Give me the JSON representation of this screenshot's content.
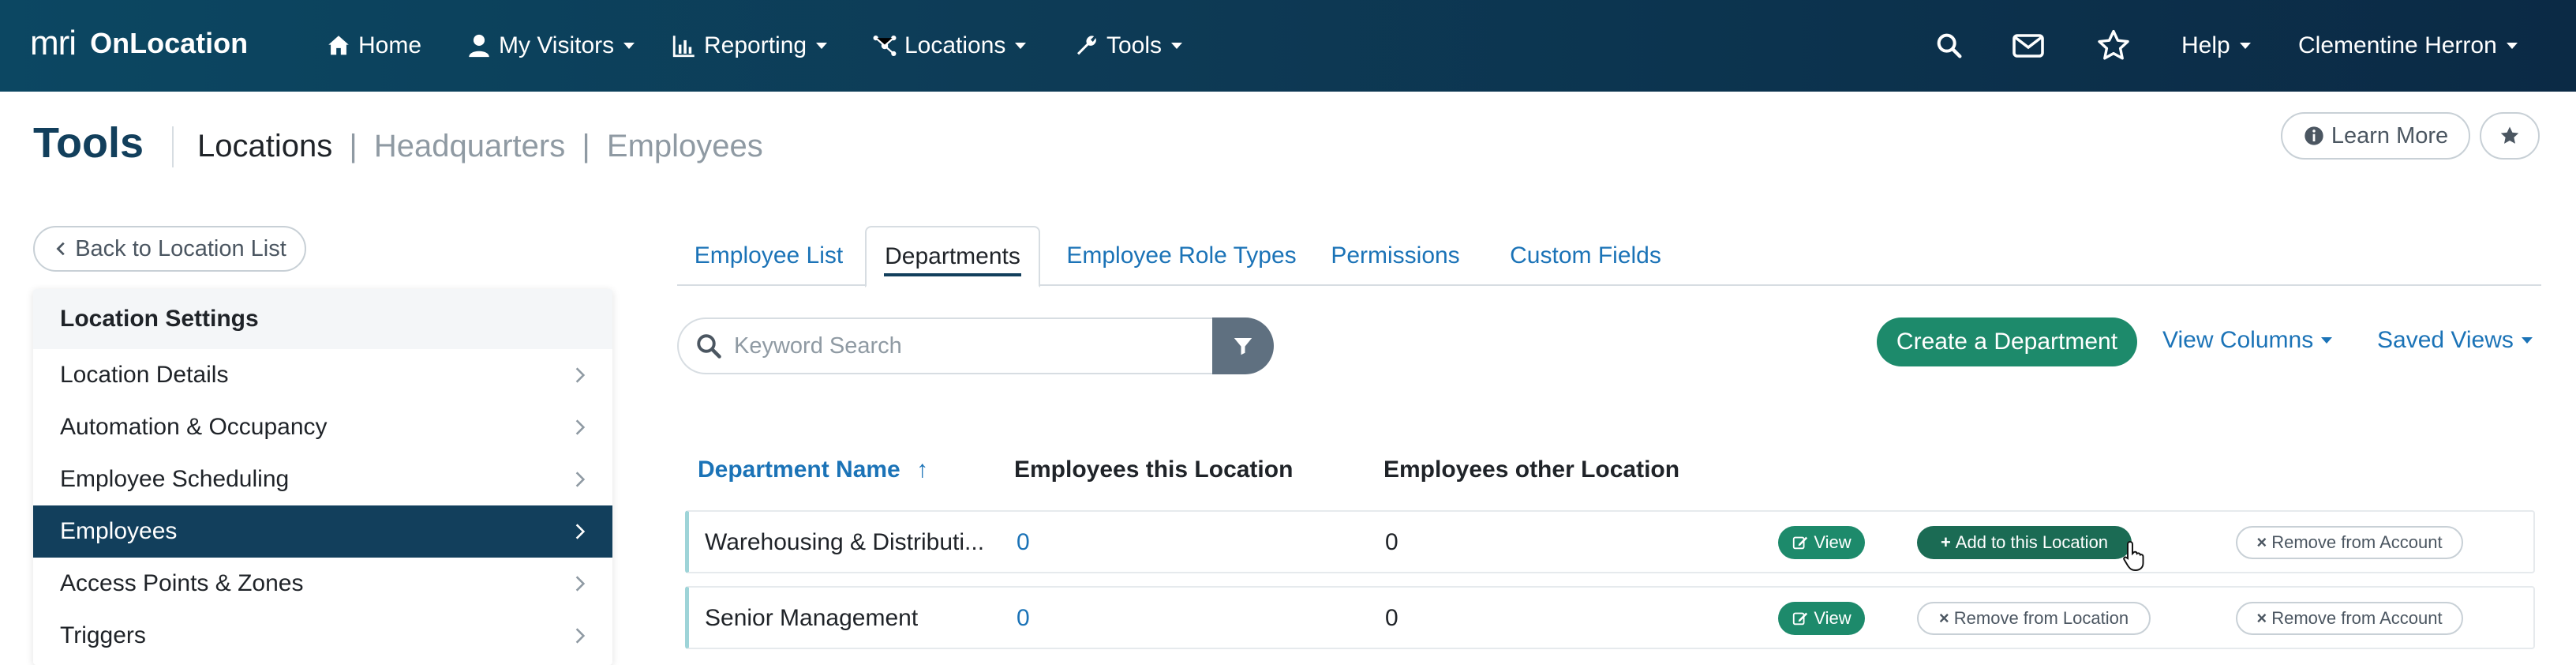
{
  "app": {
    "logo_text": "mri",
    "name": "OnLocation"
  },
  "nav": {
    "home": "Home",
    "visitors": "My Visitors",
    "reporting": "Reporting",
    "locations": "Locations",
    "tools": "Tools",
    "help": "Help",
    "user": "Clementine Herron",
    "icons": [
      "search-icon",
      "mail-icon",
      "star-icon"
    ]
  },
  "header": {
    "title": "Tools",
    "breadcrumb_main": "Locations",
    "breadcrumb_sep": "|",
    "breadcrumb_1": "Headquarters",
    "breadcrumb_2": "Employees",
    "learn_more": "Learn More"
  },
  "sidebar": {
    "back_label": "Back to Location List",
    "heading": "Location Settings",
    "items": [
      {
        "label": "Location Details"
      },
      {
        "label": "Automation & Occupancy"
      },
      {
        "label": "Employee Scheduling"
      },
      {
        "label": "Employees",
        "active": true
      },
      {
        "label": "Access Points & Zones"
      },
      {
        "label": "Triggers"
      }
    ]
  },
  "tabs": [
    {
      "label": "Employee List"
    },
    {
      "label": "Departments",
      "active": true
    },
    {
      "label": "Employee Role Types"
    },
    {
      "label": "Permissions"
    },
    {
      "label": "Custom Fields"
    }
  ],
  "toolbar": {
    "search_placeholder": "Keyword Search",
    "create_label": "Create a Department",
    "view_columns": "View Columns",
    "saved_views": "Saved Views"
  },
  "table": {
    "headers": {
      "name": "Department Name",
      "sort_arrow": "↑",
      "this_location": "Employees this Location",
      "other_location": "Employees other Location"
    },
    "rows": [
      {
        "name": "Warehousing & Distributi...",
        "this_location": "0",
        "other_location": "0",
        "view": "View",
        "location_action": "Add to this Location",
        "account_action": "Remove from Account"
      },
      {
        "name": "Senior Management",
        "this_location": "0",
        "other_location": "0",
        "view": "View",
        "location_action": "Remove from Location",
        "account_action": "Remove from Account"
      }
    ]
  },
  "colors": {
    "nav_bg": "#0d3a55",
    "brand_dark": "#123f5c",
    "link": "#1b73b7",
    "accent_green": "#1d8a6b",
    "filter_gray": "#5f7080"
  }
}
